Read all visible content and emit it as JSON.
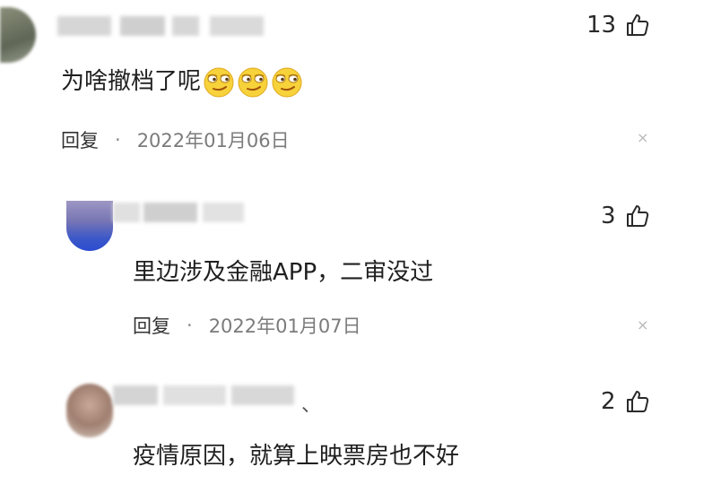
{
  "comments": [
    {
      "likes": "13",
      "text": "为啥撤档了呢",
      "emoji_count": 3,
      "reply_label": "回复",
      "separator": "·",
      "date": "2022年01月06日"
    },
    {
      "likes": "3",
      "text": "里边涉及金融APP，二审没过",
      "reply_label": "回复",
      "separator": "·",
      "date": "2022年01月07日"
    },
    {
      "likes": "2",
      "text": "疫情原因，就算上映票房也不好",
      "name_suffix": "、"
    }
  ],
  "icons": {
    "like": "thumbs-up-icon",
    "close": "close-icon",
    "emoji": "smirk-emoji-icon"
  },
  "close_glyph": "×",
  "colors": {
    "text": "#1f1f1f",
    "date": "#7b7b7b",
    "blurred_name": "#d6d6d6",
    "emoji_yellow": "#f7d23a"
  }
}
